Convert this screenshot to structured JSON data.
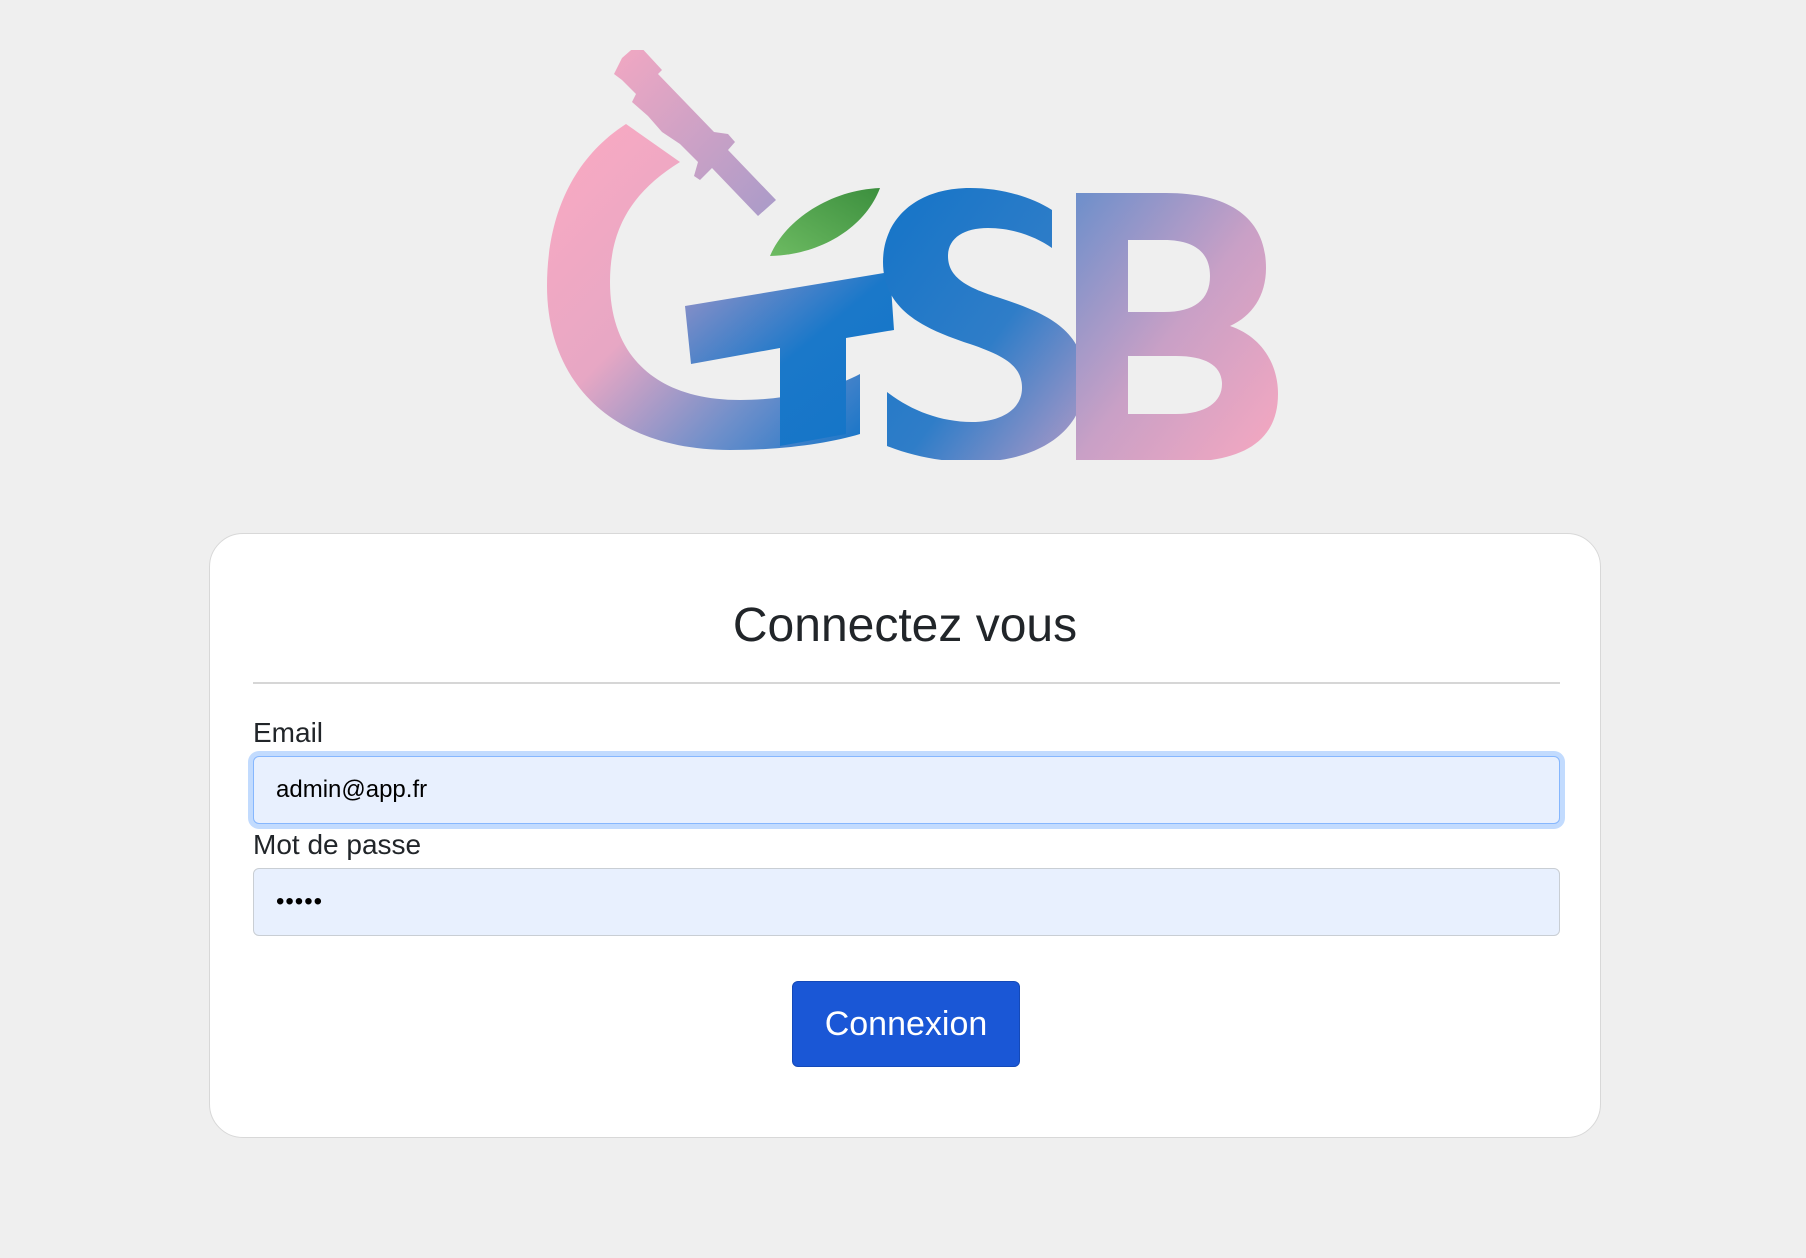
{
  "logo": {
    "text": "GSB",
    "colors": {
      "pink": "#f7a8c0",
      "blue": "#1475c8",
      "lavender": "#b49ac6",
      "leaf": "#4e9e4a"
    }
  },
  "login_card": {
    "title": "Connectez vous",
    "email": {
      "label": "Email",
      "value": "admin@app.fr"
    },
    "password": {
      "label": "Mot de passe",
      "value": "•••••"
    },
    "submit_label": "Connexion"
  },
  "colors": {
    "background": "#efefef",
    "card": "#ffffff",
    "input_fill": "#e8f0fe",
    "button": "#1a57d6"
  }
}
